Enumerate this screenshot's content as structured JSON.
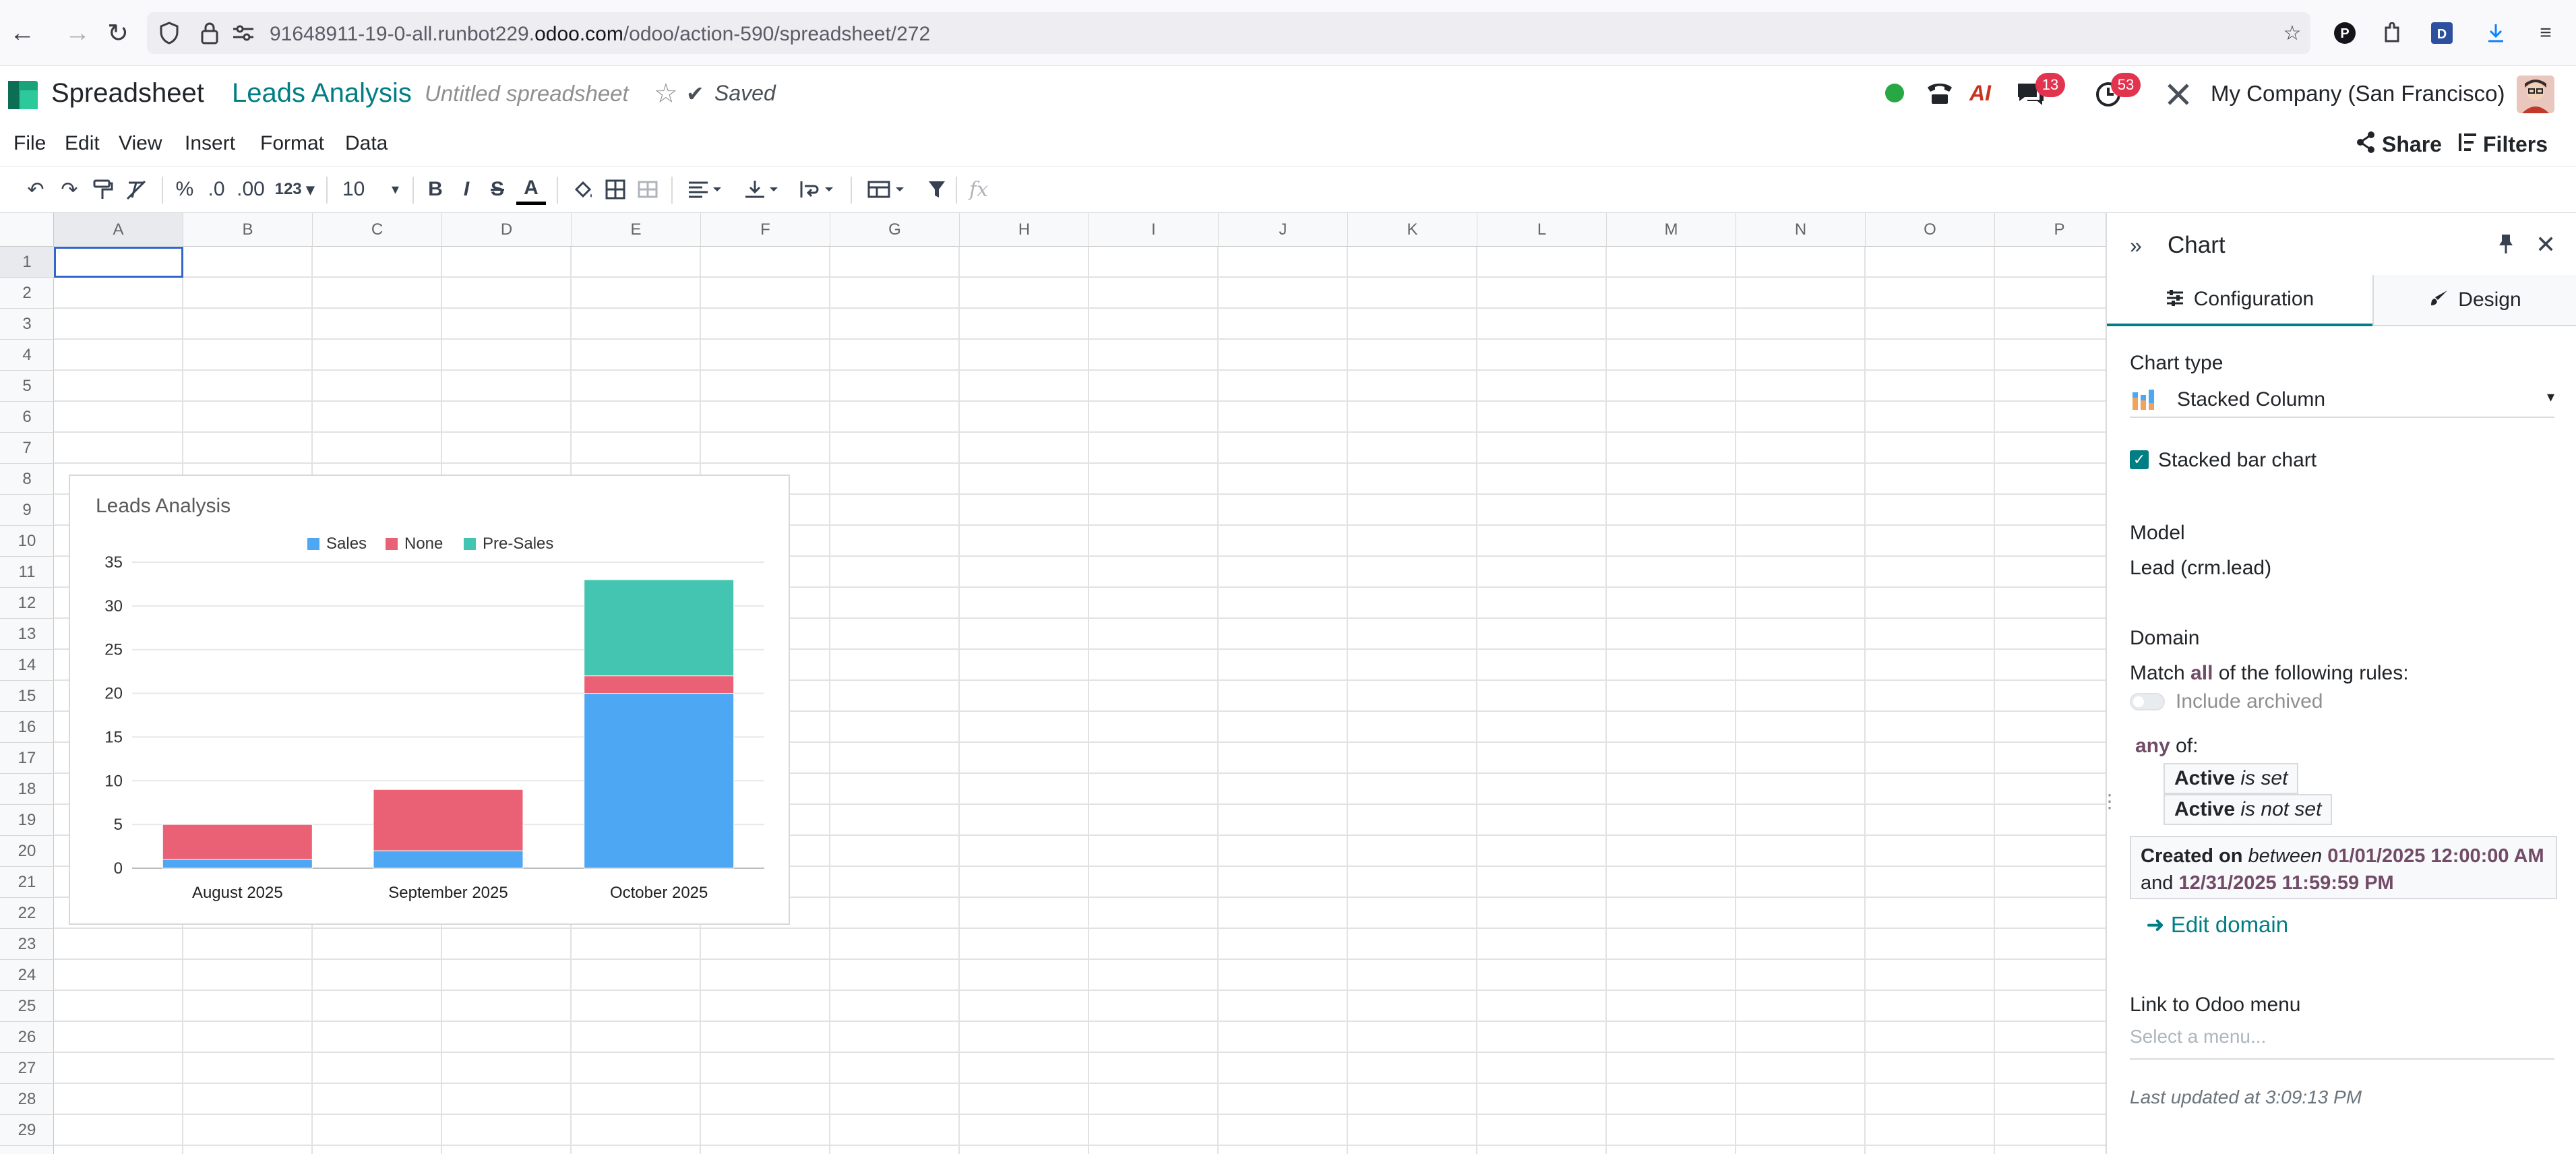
{
  "browser": {
    "url_prefix": "91648911-19-0-all.runbot229.",
    "url_domain": "odoo.com",
    "url_suffix": "/odoo/action-590/spreadsheet/272"
  },
  "app": {
    "name": "Spreadsheet",
    "document_title": "Leads Analysis",
    "subtitle": "Untitled spreadsheet",
    "saved_label": "Saved",
    "company": "My Company (San Francisco)",
    "messages_count": "13",
    "activities_count": "53",
    "share_label": "Share",
    "filters_label": "Filters",
    "ai_label": "AI"
  },
  "menu": [
    "File",
    "Edit",
    "View",
    "Insert",
    "Format",
    "Data"
  ],
  "toolbar": {
    "percent": "%",
    "dec_decimal": ".0",
    "inc_decimal": ".00",
    "format": "123",
    "font_size": "10",
    "bold": "B",
    "italic": "I",
    "strike": "S",
    "text_color": "A",
    "fx": "fx"
  },
  "grid": {
    "columns": [
      "A",
      "B",
      "C",
      "D",
      "E",
      "F",
      "G",
      "H",
      "I",
      "J",
      "K",
      "L",
      "M",
      "N",
      "O",
      "P"
    ],
    "rows": [
      "1",
      "2",
      "3",
      "4",
      "5",
      "6",
      "7",
      "8",
      "9",
      "10",
      "11",
      "12",
      "13",
      "14",
      "15",
      "16",
      "17",
      "18",
      "19",
      "20",
      "21",
      "22",
      "23",
      "24",
      "25",
      "26",
      "27",
      "28",
      "29"
    ]
  },
  "chart_data": {
    "type": "bar",
    "stacked": true,
    "title": "Leads Analysis",
    "categories": [
      "August 2025",
      "September 2025",
      "October 2025"
    ],
    "series": [
      {
        "name": "Sales",
        "color": "#4ea7f2",
        "values": [
          1,
          2,
          20
        ]
      },
      {
        "name": "None",
        "color": "#ea6175",
        "values": [
          4,
          7,
          2
        ]
      },
      {
        "name": "Pre-Sales",
        "color": "#43c5b1",
        "values": [
          0,
          0,
          11
        ]
      }
    ],
    "ylim": [
      0,
      35
    ],
    "yticks": [
      "0",
      "5",
      "10",
      "15",
      "20",
      "25",
      "30",
      "35"
    ],
    "legend_position": "top",
    "grid": true
  },
  "panel": {
    "title": "Chart",
    "tab_config": "Configuration",
    "tab_design": "Design",
    "chart_type_label": "Chart type",
    "chart_type_value": "Stacked Column",
    "stacked_label": "Stacked bar chart",
    "model_label": "Model",
    "model_value": "Lead (crm.lead)",
    "domain_label": "Domain",
    "match_pre": "Match",
    "match_all": "all",
    "match_post": "of the following rules:",
    "include_archived": "Include archived",
    "any_word": "any",
    "any_of": "of:",
    "rule1_field": "Active",
    "rule1_op": "is set",
    "rule2_field": "Active",
    "rule2_op": "is not set",
    "rule3_field": "Created on",
    "rule3_op": "between",
    "rule3_from": "01/01/2025 12:00:00 AM",
    "rule3_and": "and",
    "rule3_to": "12/31/2025 11:59:59 PM",
    "edit_domain": "Edit domain",
    "link_menu_label": "Link to Odoo menu",
    "link_menu_placeholder": "Select a menu...",
    "last_updated": "Last updated at 3:09:13 PM"
  },
  "colors": {
    "brand_teal": "#017e84",
    "brand_purple": "#714b67",
    "badge_red": "#e2334f",
    "online_green": "#28a745"
  }
}
